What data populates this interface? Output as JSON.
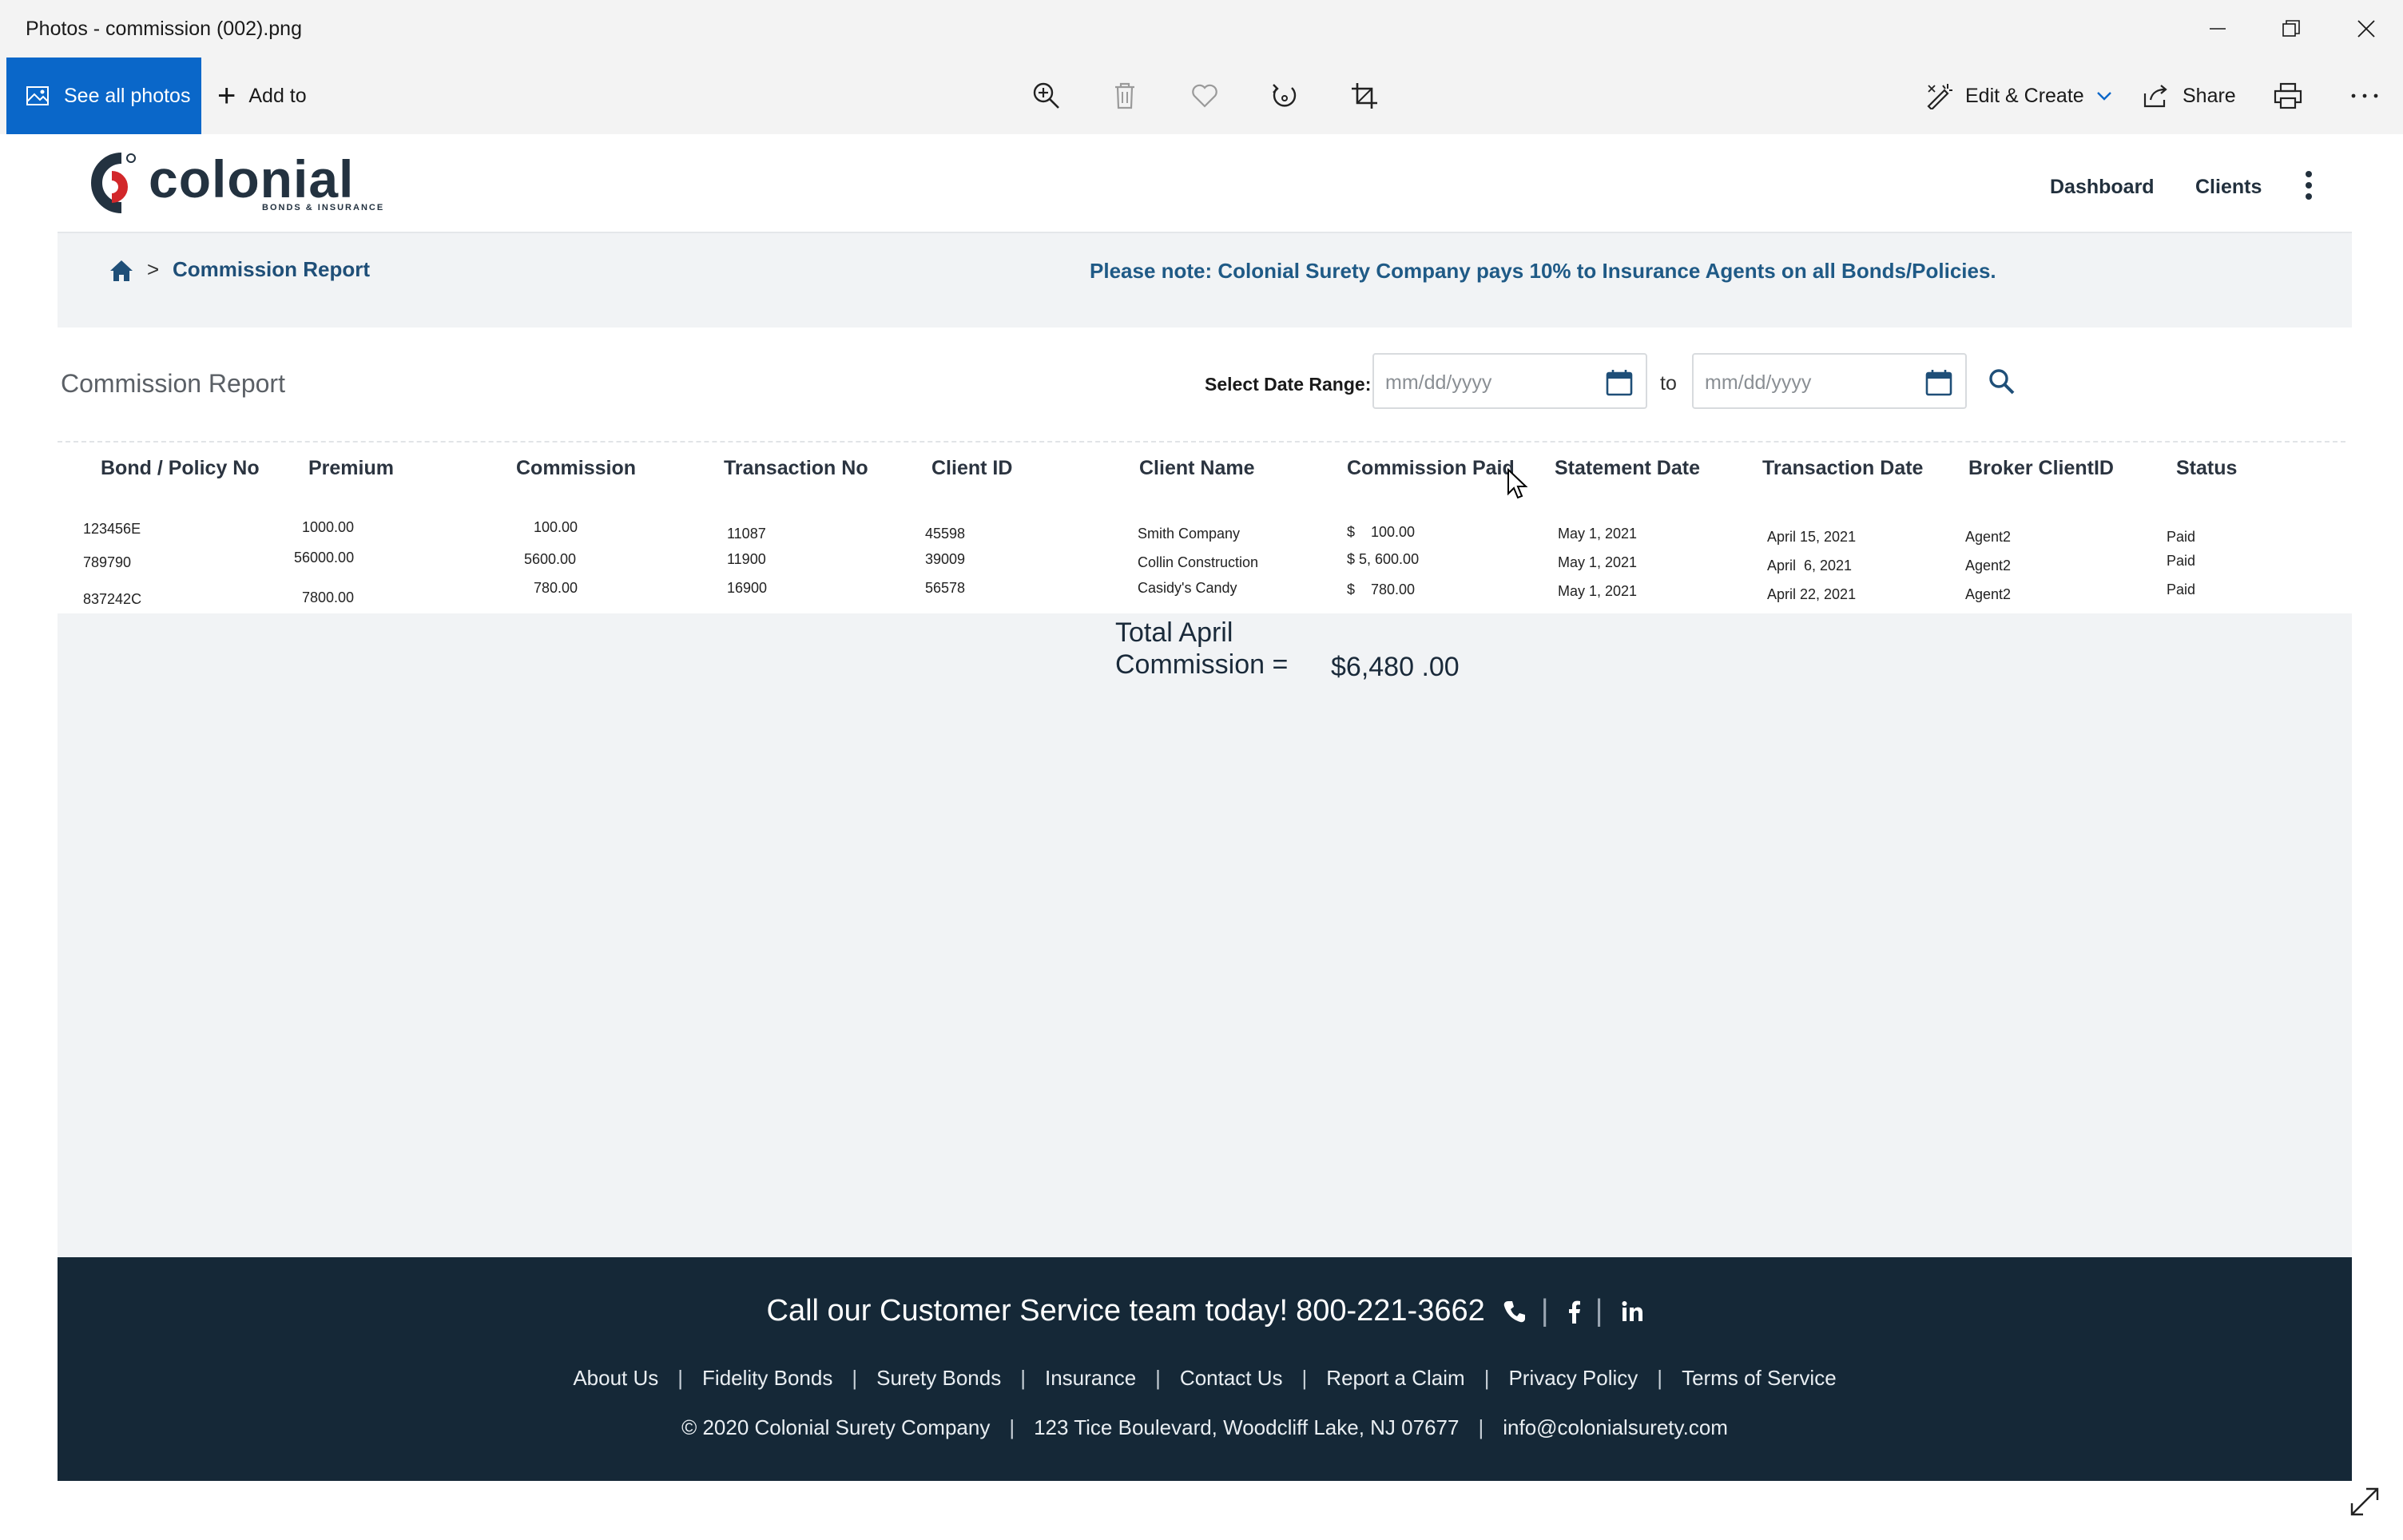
{
  "window": {
    "title": "Photos - commission (002).png"
  },
  "toolbar": {
    "see_all_photos": "See all photos",
    "add_to": "Add to",
    "edit_create": "Edit & Create",
    "share": "Share"
  },
  "site": {
    "logo_word": "colonial",
    "logo_tagline": "BONDS & INSURANCE",
    "nav": [
      "Dashboard",
      "Clients"
    ]
  },
  "breadcrumb": {
    "current": "Commission Report",
    "separator": ">"
  },
  "notice": "Please note: Colonial Surety Company pays 10% to Insurance Agents on all Bonds/Policies.",
  "report": {
    "title": "Commission Report",
    "date_range_label": "Select Date Range:",
    "from_placeholder": "mm/dd/yyyy",
    "to_label": "to",
    "to_placeholder": "mm/dd/yyyy"
  },
  "table": {
    "columns": [
      "Bond / Policy No",
      "Premium",
      "Commission",
      "Transaction No",
      "Client ID",
      "Client Name",
      "Commission Paid",
      "Statement Date",
      "Transaction Date",
      "Broker ClientID",
      "Status"
    ],
    "rows": [
      [
        "123456E",
        "1000.00",
        "100.00",
        "11087",
        "45598",
        "Smith Company",
        "$    100.00",
        "May 1, 2021",
        "April 15, 2021",
        "Agent2",
        "Paid"
      ],
      [
        "789790",
        "56000.00",
        "5600.00",
        "11900",
        "39009",
        "Collin Construction",
        "$ 5, 600.00",
        "May 1, 2021",
        "April  6, 2021",
        "Agent2",
        "Paid"
      ],
      [
        "837242C",
        "7800.00",
        "780.00",
        "16900",
        "56578",
        "Casidy's Candy",
        "$    780.00",
        "May 1, 2021",
        "April 22, 2021",
        "Agent2",
        "Paid"
      ]
    ]
  },
  "summary": {
    "label": "Total April Commission =",
    "value": "$6,480 .00"
  },
  "footer": {
    "cta": "Call our Customer Service team today!",
    "phone": "800-221-3662",
    "links": [
      "About Us",
      "Fidelity Bonds",
      "Surety Bonds",
      "Insurance",
      "Contact Us",
      "Report a Claim",
      "Privacy Policy",
      "Terms of Service"
    ],
    "copyright": "© 2020 Colonial Surety Company",
    "address": "123 Tice Boulevard, Woodcliff Lake, NJ 07677",
    "email": "info@colonialsurety.com",
    "link_separator": "|"
  },
  "colors": {
    "accent": "#0a67c9",
    "brand_dark": "#152837",
    "brand_red": "#d2272a",
    "notice_text": "#1f5a86"
  },
  "icons": [
    "photos-icon",
    "plus-icon",
    "zoom-in-icon",
    "delete-icon",
    "heart-icon",
    "rotate-icon",
    "crop-icon",
    "edit-create-icon",
    "chevron-down-icon",
    "share-icon",
    "print-icon",
    "more-icon",
    "minimize-icon",
    "maximize-icon",
    "close-icon",
    "home-icon",
    "calendar-icon",
    "search-icon",
    "kebab-menu-icon",
    "phone-icon",
    "facebook-icon",
    "linkedin-icon",
    "expand-icon",
    "cursor-icon"
  ]
}
